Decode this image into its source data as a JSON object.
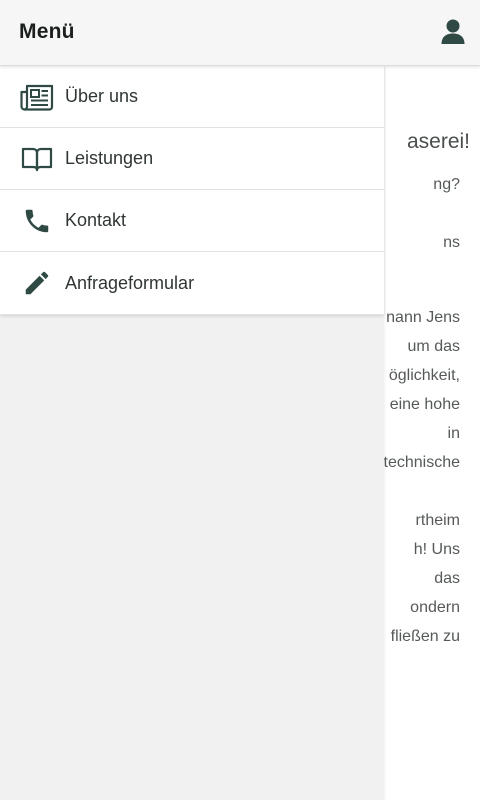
{
  "header": {
    "title": "Menü",
    "user_icon": "user-icon"
  },
  "drawer": {
    "items": [
      {
        "label": "Über uns",
        "icon": "newspaper-icon"
      },
      {
        "label": "Leistungen",
        "icon": "book-icon"
      },
      {
        "label": "Kontakt",
        "icon": "phone-icon"
      },
      {
        "label": "Anfrageformular",
        "icon": "pencil-icon"
      }
    ]
  },
  "background_content": {
    "heading": "aserei!",
    "lines": [
      "ng?",
      "ns",
      "nann Jens",
      "um das",
      "öglichkeit,",
      "eine hohe",
      "in",
      "technische",
      "rtheim",
      "h! Uns",
      "das",
      "ondern",
      "fließen zu"
    ]
  },
  "colors": {
    "icon": "#2f4a45",
    "text": "#2f3634",
    "drawer_background": "#f1f1f1",
    "topbar_background": "#f5f6f5"
  }
}
